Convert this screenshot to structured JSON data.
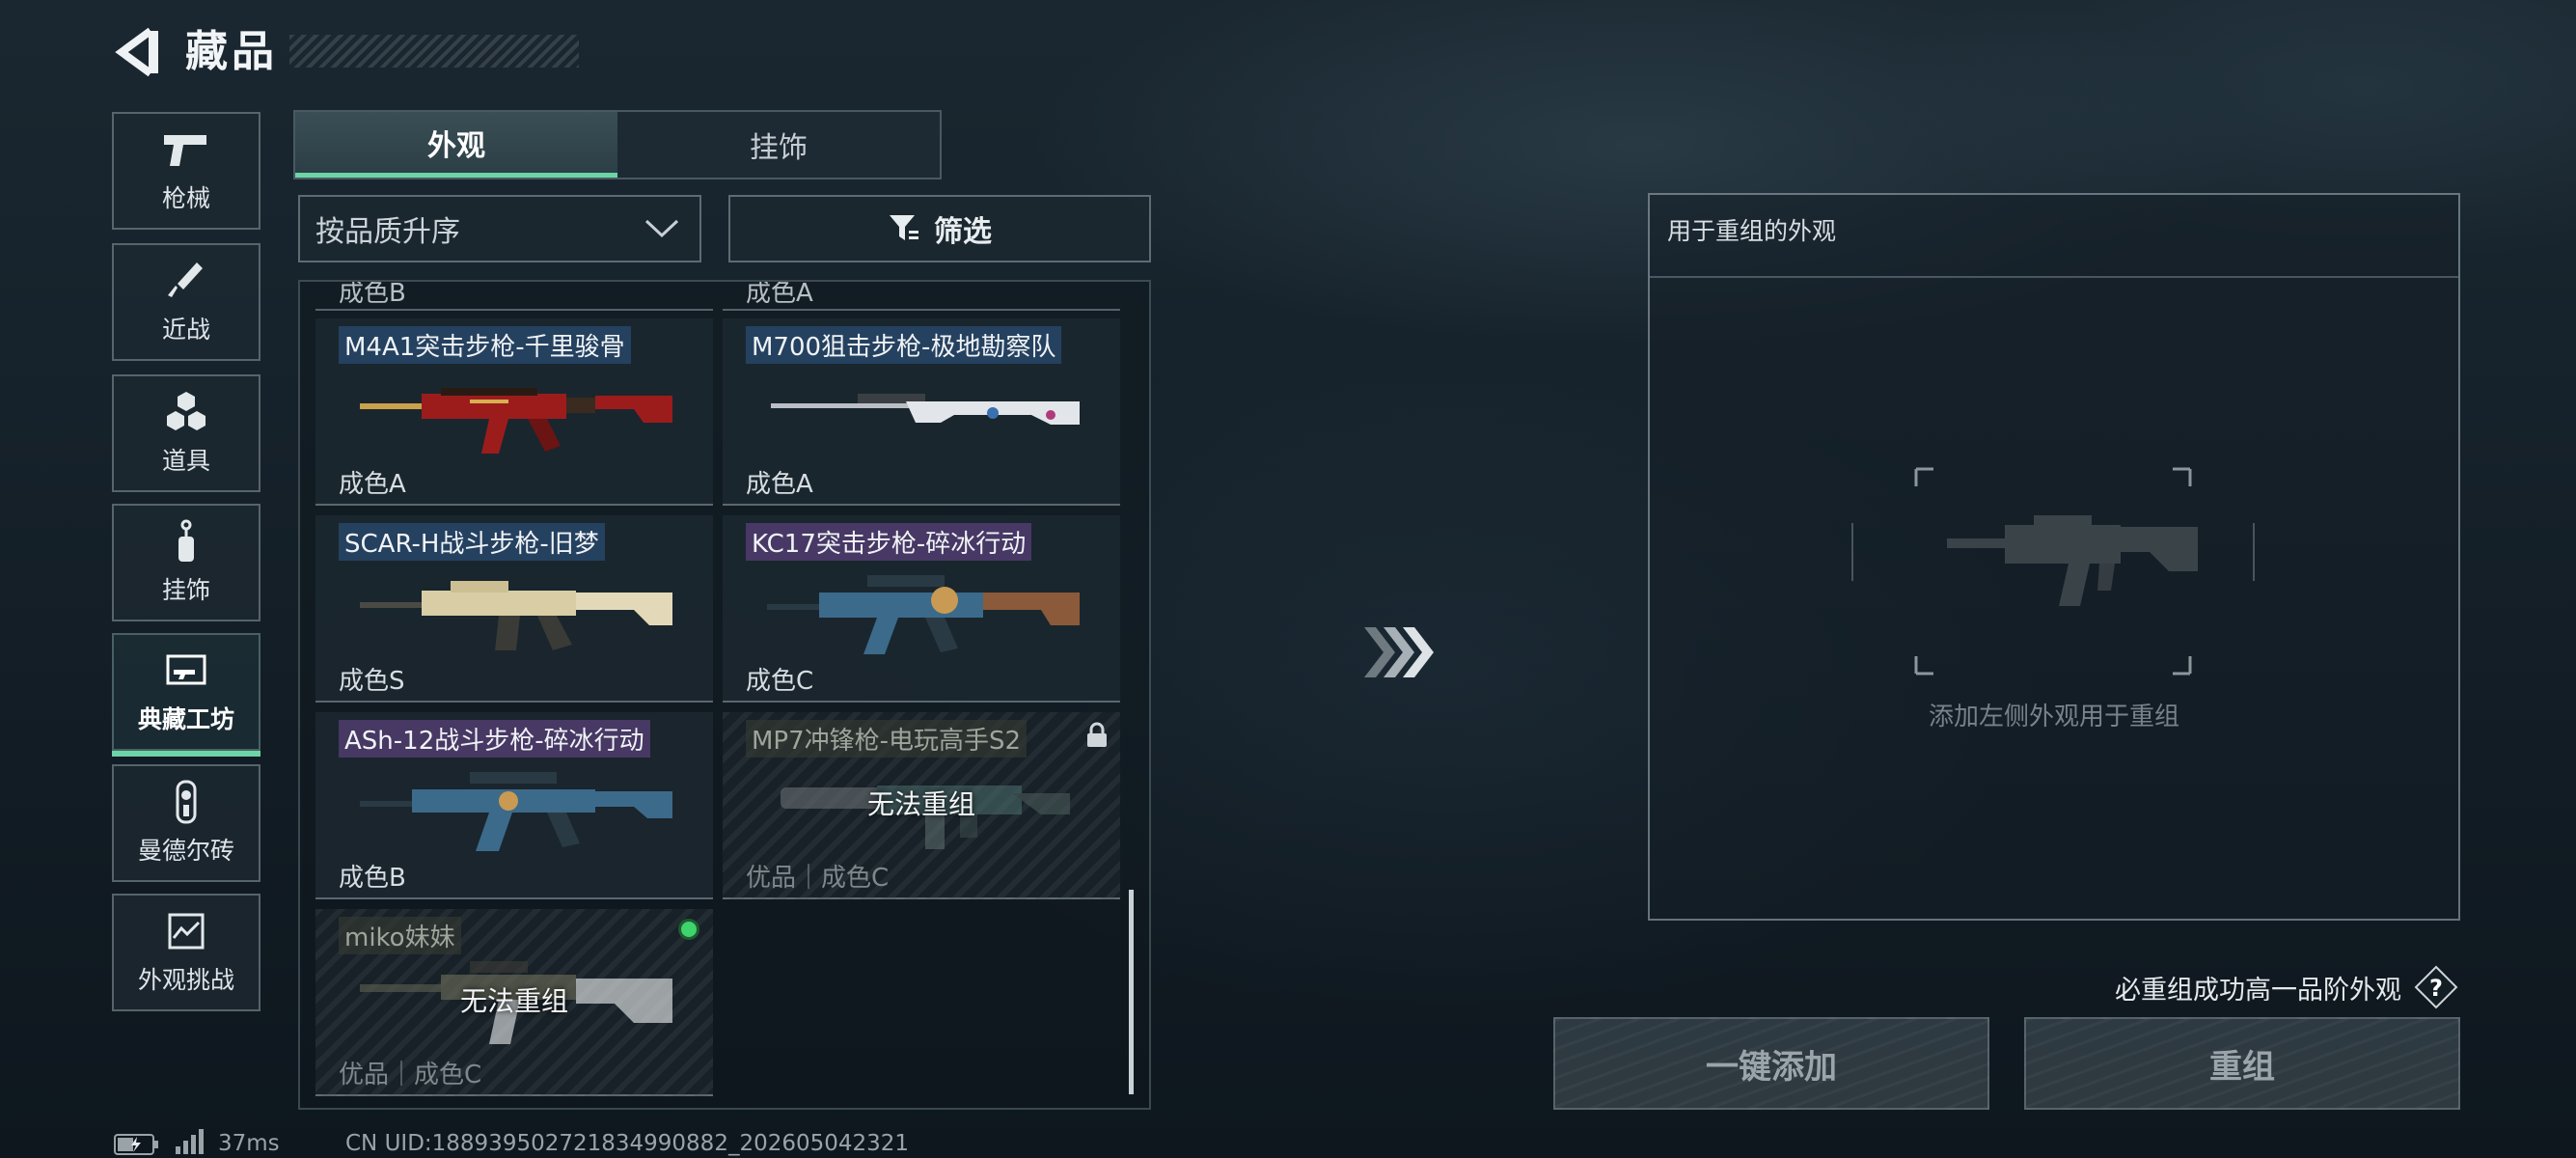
{
  "header": {
    "title": "藏品",
    "back_icon": "back-arrow-icon"
  },
  "sidebar": {
    "items": [
      {
        "label": "枪械",
        "icon": "pistol-icon",
        "active": false
      },
      {
        "label": "近战",
        "icon": "knife-icon",
        "active": false
      },
      {
        "label": "道具",
        "icon": "grenades-icon",
        "active": false
      },
      {
        "label": "挂饰",
        "icon": "charm-icon",
        "active": false
      },
      {
        "label": "典藏工坊",
        "icon": "workshop-icon",
        "active": true
      },
      {
        "label": "曼德尔砖",
        "icon": "brick-icon",
        "active": false
      },
      {
        "label": "外观挑战",
        "icon": "challenge-icon",
        "active": false
      }
    ]
  },
  "tabs": [
    {
      "label": "外观",
      "active": true
    },
    {
      "label": "挂饰",
      "active": false
    }
  ],
  "sort": {
    "value": "按品质升序"
  },
  "filter": {
    "label": "筛选"
  },
  "grid": {
    "partial_top": [
      "成色B",
      "成色A"
    ],
    "items": [
      {
        "name": "M4A1突击步枪-千里骏骨",
        "grade": "成色A",
        "tag_color": "blue",
        "locked": false
      },
      {
        "name": "M700狙击步枪-极地勘察队",
        "grade": "成色A",
        "tag_color": "blue",
        "locked": false
      },
      {
        "name": "SCAR-H战斗步枪-旧梦",
        "grade": "成色S",
        "tag_color": "blue",
        "locked": false
      },
      {
        "name": "KC17突击步枪-碎冰行动",
        "grade": "成色C",
        "tag_color": "purple",
        "locked": false
      },
      {
        "name": "ASh-12战斗步枪-碎冰行动",
        "grade": "成色B",
        "tag_color": "purple",
        "locked": false
      },
      {
        "name": "MP7冲锋枪-电玩高手S2",
        "grade": "优品｜成色C",
        "tag_color": "gray",
        "locked": true,
        "overlay": "无法重组",
        "badge": "lock-icon"
      },
      {
        "name": "miko妹妹",
        "grade": "优品｜成色C",
        "tag_color": "gray",
        "locked": true,
        "overlay": "无法重组",
        "badge": "green-dot"
      }
    ]
  },
  "right_panel": {
    "title": "用于重组的外观",
    "placeholder": "添加左侧外观用于重组"
  },
  "guarantee": {
    "text": "必重组成功高一品阶外观",
    "help": "?"
  },
  "buttons": {
    "quick_add": "一键添加",
    "recombine": "重组"
  },
  "status": {
    "ping": "37ms",
    "uid": "CN UID:1889395027218349908​82_202605042321"
  },
  "colors": {
    "accent": "#6cd4a6",
    "blue_tag": "#284669",
    "purple_tag": "#503c6e"
  }
}
